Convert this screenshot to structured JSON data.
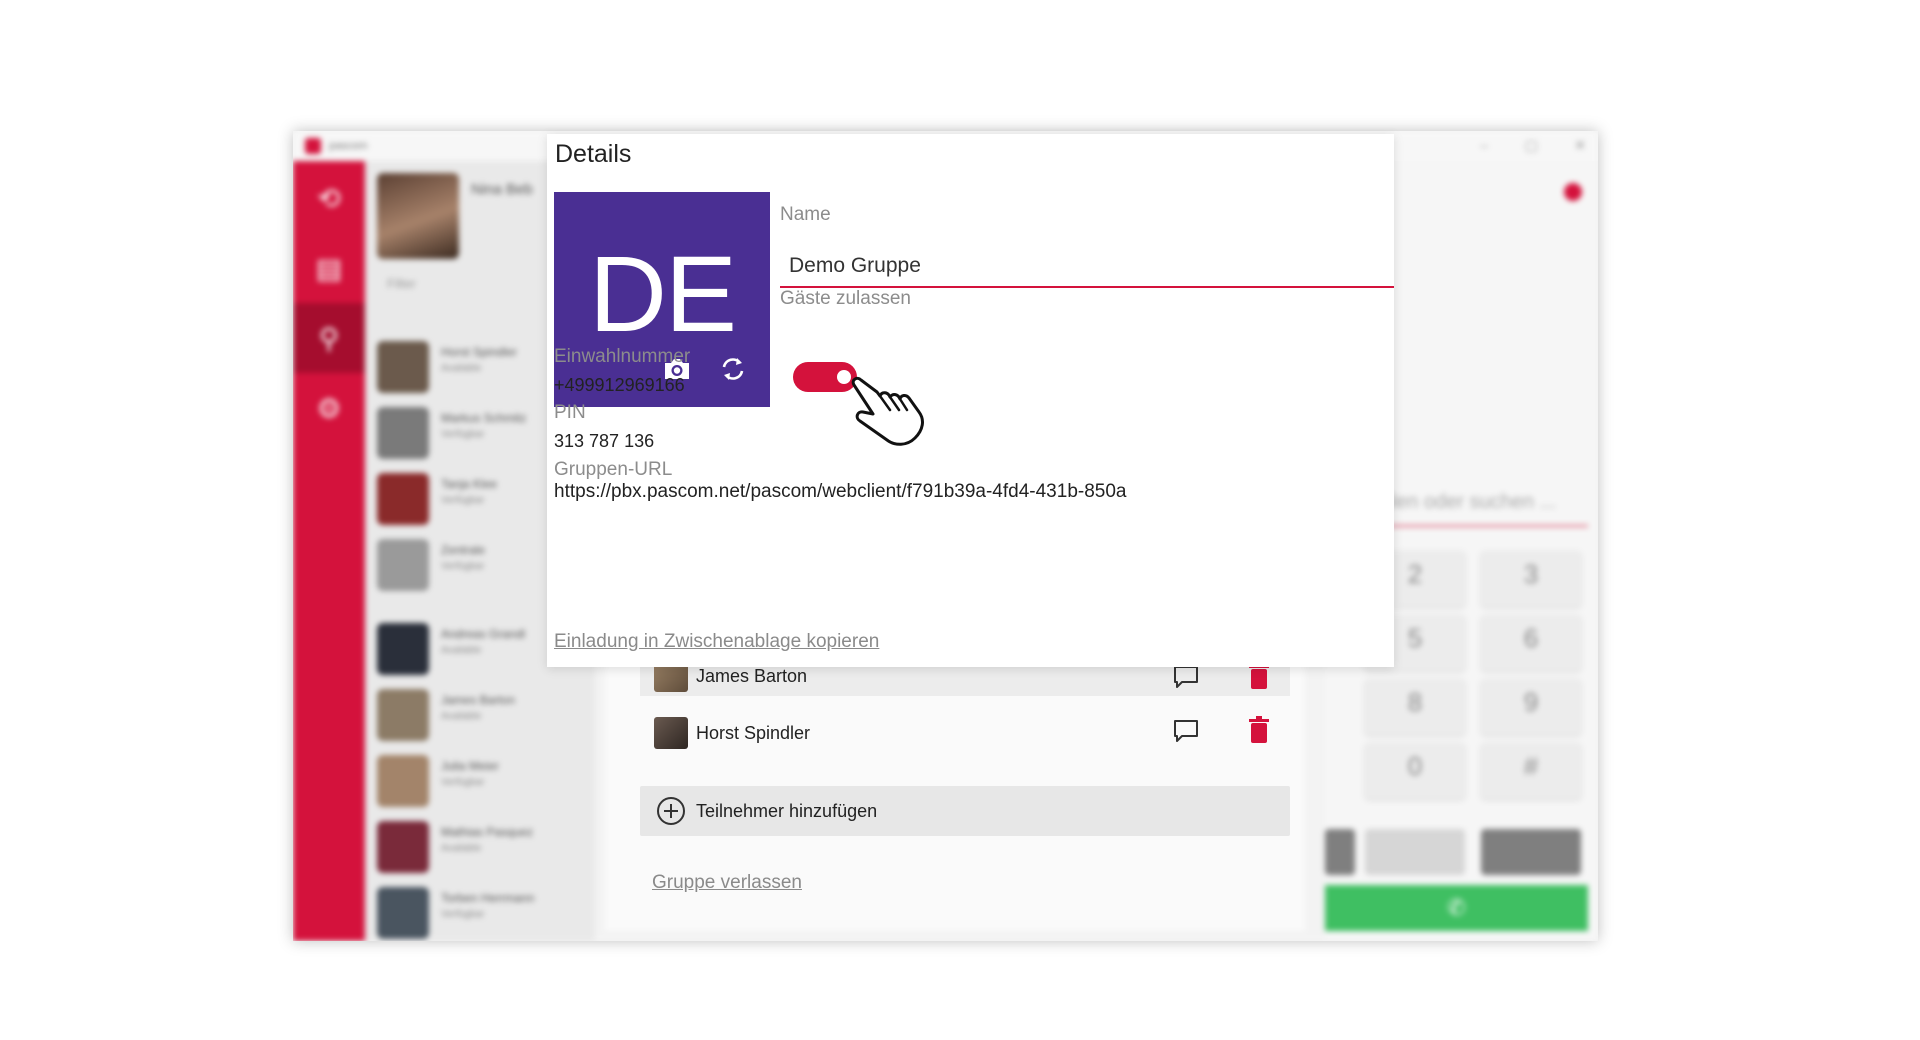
{
  "app": {
    "title": "pascom",
    "user_name": "Nina Beb",
    "search_placeholder": "Filter",
    "contacts": [
      {
        "name": "Horst Spindler",
        "status": "Available"
      },
      {
        "name": "Markus Schmitz",
        "status": "Verfügbar"
      },
      {
        "name": "Tanja Klee",
        "status": "Verfügbar"
      },
      {
        "name": "Zentrale",
        "status": "Verfügbar"
      },
      {
        "name": "Andreas Grandl",
        "status": "Available"
      },
      {
        "name": "James Barton",
        "status": "Available"
      },
      {
        "name": "Julia Meier",
        "status": "Verfügbar"
      },
      {
        "name": "Mathias Pasquez",
        "status": "Available"
      },
      {
        "name": "Torben Herrmann",
        "status": "Verfügbar"
      }
    ],
    "dialer": {
      "input_placeholder": "wählen oder suchen ...",
      "keys": [
        "2",
        "3",
        "5",
        "6",
        "8",
        "9",
        "0",
        "#"
      ]
    }
  },
  "details": {
    "title": "Details",
    "avatar_initials": "DE",
    "avatar_color": "#4a2f93",
    "name_label": "Name",
    "name_value": "Demo Gruppe",
    "guests_label": "Gäste zulassen",
    "guests_enabled": true,
    "dialin_label": "Einwahlnummer",
    "dialin_value": "+499912969166",
    "pin_label": "PIN",
    "pin_value": "313 787 136",
    "url_label": "Gruppen-URL",
    "url_value": "https://pbx.pascom.net/pascom/webclient/f791b39a-4fd4-431b-850a",
    "copy_invite_label": "Einladung in Zwischenablage kopieren"
  },
  "participants": {
    "members": [
      {
        "name": "James Barton"
      },
      {
        "name": "Horst Spindler"
      }
    ],
    "add_label": "Teilnehmer hinzufügen",
    "leave_label": "Gruppe verlassen"
  },
  "colors": {
    "brand_red": "#d4123c",
    "call_green": "#3fbf62"
  }
}
